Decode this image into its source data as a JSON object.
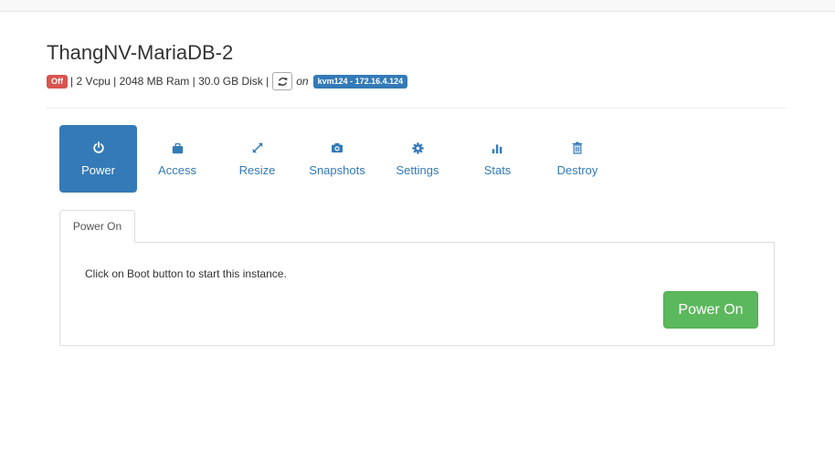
{
  "instance": {
    "name": "ThangNV-MariaDB-2",
    "status": "Off",
    "specs": "| 2 Vcpu | 2048 MB Ram | 30.0 GB Disk |",
    "on_text": "on",
    "host": "kvm124 - 172.16.4.124"
  },
  "nav": {
    "items": [
      {
        "label": "Power",
        "icon": "power-icon"
      },
      {
        "label": "Access",
        "icon": "briefcase-icon"
      },
      {
        "label": "Resize",
        "icon": "resize-icon"
      },
      {
        "label": "Snapshots",
        "icon": "camera-icon"
      },
      {
        "label": "Settings",
        "icon": "gear-icon"
      },
      {
        "label": "Stats",
        "icon": "bar-chart-icon"
      },
      {
        "label": "Destroy",
        "icon": "trash-icon"
      }
    ],
    "active": "Power"
  },
  "tabs": {
    "active_label": "Power On"
  },
  "panel": {
    "message": "Click on Boot button to start this instance.",
    "button_label": "Power On"
  },
  "colors": {
    "primary": "#337ab7",
    "danger": "#d9534f",
    "success": "#5cb85c"
  }
}
